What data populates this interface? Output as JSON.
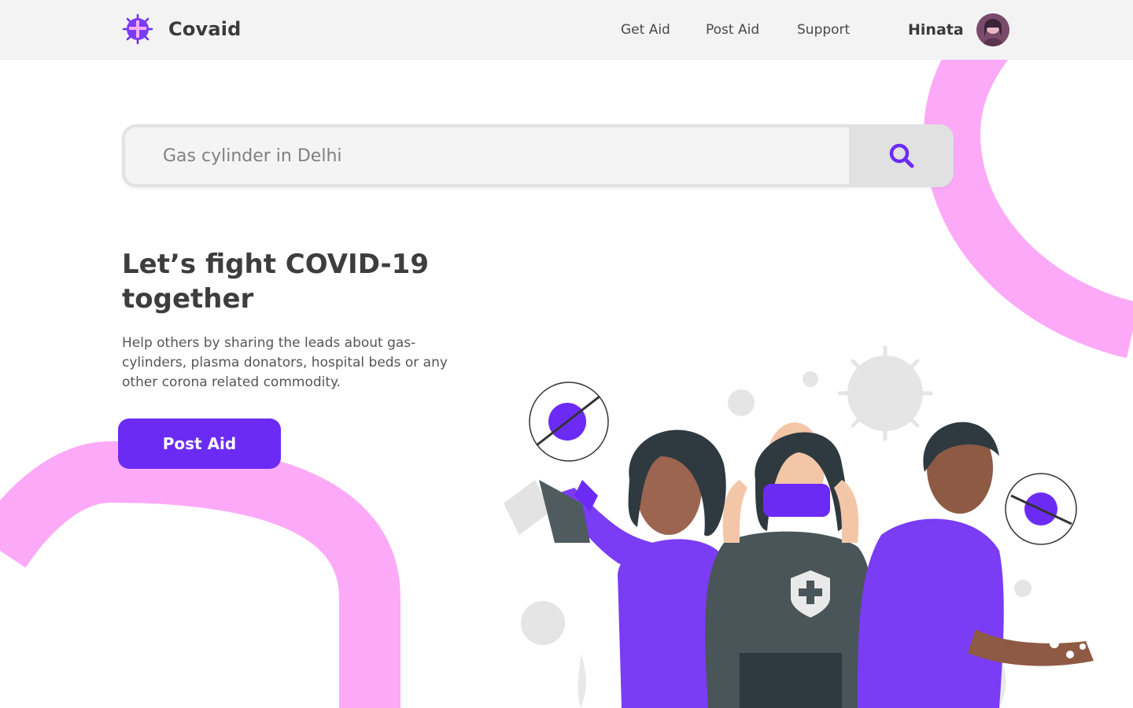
{
  "header": {
    "brand_name": "Covaid",
    "nav": [
      {
        "label": "Get Aid"
      },
      {
        "label": "Post Aid"
      },
      {
        "label": "Support"
      }
    ],
    "user_name": "Hinata"
  },
  "search": {
    "placeholder": "Gas cylinder in Delhi",
    "icon": "search-icon"
  },
  "hero": {
    "title": "Let’s fight COVID-19 together",
    "description": "Help others by sharing the leads about gas-cylinders, plasma donators, hospital beds or any other corona related commodity.",
    "cta_label": "Post Aid"
  },
  "colors": {
    "accent": "#6c2bf5",
    "blob": "#fcaaf7",
    "header_bg": "#f3f3f3"
  }
}
